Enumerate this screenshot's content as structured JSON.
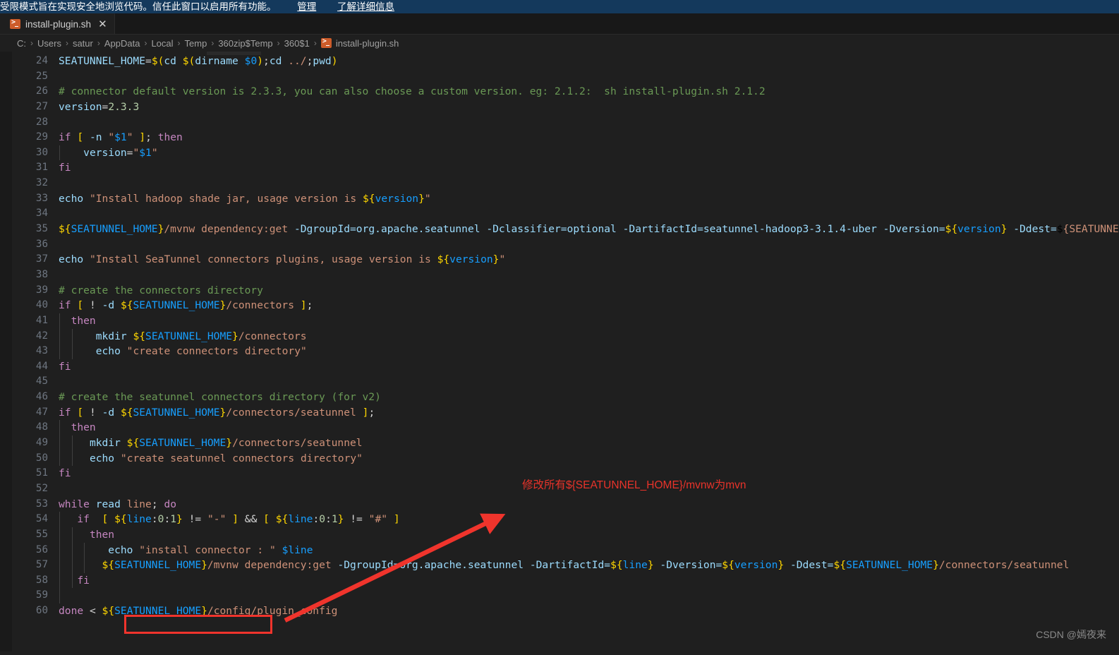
{
  "banner": {
    "message": "受限模式旨在实现安全地浏览代码。信任此窗口以启用所有功能。",
    "manage_label": "管理",
    "learn_more_label": "了解详细信息",
    "background": "#14395c"
  },
  "tab": {
    "title": "install-plugin.sh",
    "close_label": "✕",
    "icon": "shell-script-icon"
  },
  "breadcrumb": {
    "separator": "›",
    "items": [
      "C:",
      "Users",
      "satur",
      "AppData",
      "Local",
      "Temp",
      "360zip$Temp",
      "360$1"
    ],
    "file": "install-plugin.sh"
  },
  "editor": {
    "background": "#1f1f1f",
    "first_line": 24,
    "last_line": 60,
    "lines": [
      {
        "n": 24,
        "text": "SEATUNNEL_HOME=$(cd $(dirname $0);cd ../;pwd)"
      },
      {
        "n": 25,
        "text": ""
      },
      {
        "n": 26,
        "text": "# connector default version is 2.3.3, you can also choose a custom version. eg: 2.1.2:  sh install-plugin.sh 2.1.2"
      },
      {
        "n": 27,
        "text": "version=2.3.3"
      },
      {
        "n": 28,
        "text": ""
      },
      {
        "n": 29,
        "text": "if [ -n \"$1\" ]; then"
      },
      {
        "n": 30,
        "text": "    version=\"$1\""
      },
      {
        "n": 31,
        "text": "fi"
      },
      {
        "n": 32,
        "text": ""
      },
      {
        "n": 33,
        "text": "echo \"Install hadoop shade jar, usage version is ${version}\""
      },
      {
        "n": 34,
        "text": ""
      },
      {
        "n": 35,
        "text": "${SEATUNNEL_HOME}/mvnw dependency:get -DgroupId=org.apache.seatunnel -Dclassifier=optional -DartifactId=seatunnel-hadoop3-3.1.4-uber -Dversion=${version} -Ddest=${SEATUNNEL"
      },
      {
        "n": 36,
        "text": ""
      },
      {
        "n": 37,
        "text": "echo \"Install SeaTunnel connectors plugins, usage version is ${version}\""
      },
      {
        "n": 38,
        "text": ""
      },
      {
        "n": 39,
        "text": "# create the connectors directory"
      },
      {
        "n": 40,
        "text": "if [ ! -d ${SEATUNNEL_HOME}/connectors ];"
      },
      {
        "n": 41,
        "text": "  then"
      },
      {
        "n": 42,
        "text": "      mkdir ${SEATUNNEL_HOME}/connectors"
      },
      {
        "n": 43,
        "text": "      echo \"create connectors directory\""
      },
      {
        "n": 44,
        "text": "fi"
      },
      {
        "n": 45,
        "text": ""
      },
      {
        "n": 46,
        "text": "# create the seatunnel connectors directory (for v2)"
      },
      {
        "n": 47,
        "text": "if [ ! -d ${SEATUNNEL_HOME}/connectors/seatunnel ];"
      },
      {
        "n": 48,
        "text": "  then"
      },
      {
        "n": 49,
        "text": "     mkdir ${SEATUNNEL_HOME}/connectors/seatunnel"
      },
      {
        "n": 50,
        "text": "     echo \"create seatunnel connectors directory\""
      },
      {
        "n": 51,
        "text": "fi"
      },
      {
        "n": 52,
        "text": ""
      },
      {
        "n": 53,
        "text": "while read line; do"
      },
      {
        "n": 54,
        "text": "   if  [ ${line:0:1} != \"-\" ] && [ ${line:0:1} != \"#\" ]"
      },
      {
        "n": 55,
        "text": "     then"
      },
      {
        "n": 56,
        "text": "        echo \"install connector : \" $line"
      },
      {
        "n": 57,
        "text": "       ${SEATUNNEL_HOME}/mvnw dependency:get -DgroupId=org.apache.seatunnel -DartifactId=${line} -Dversion=${version} -Ddest=${SEATUNNEL_HOME}/connectors/seatunnel"
      },
      {
        "n": 58,
        "text": "   fi"
      },
      {
        "n": 59,
        "text": ""
      },
      {
        "n": 60,
        "text": "done < ${SEATUNNEL_HOME}/config/plugin_config"
      }
    ]
  },
  "annotation": {
    "text": "修改所有${SEATUNNEL_HOME}/mvnw为mvn",
    "color": "#e8332a",
    "highlight_target_line": 57,
    "highlight_target_text": "${SEATUNNEL_HOME}/mvnw"
  },
  "watermark": {
    "text": "CSDN @嫣夜来"
  }
}
